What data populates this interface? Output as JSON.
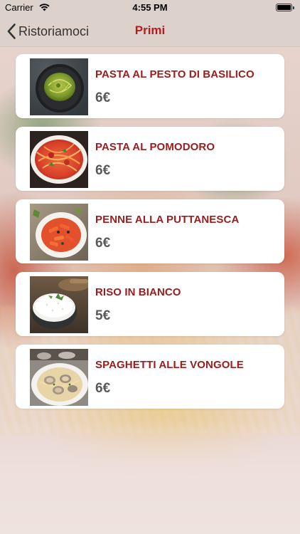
{
  "status_bar": {
    "carrier": "Carrier",
    "time": "4:55 PM"
  },
  "nav": {
    "back_label": "Ristoriamoci",
    "title": "Primi",
    "title_color": "#b51c1c"
  },
  "colors": {
    "dish_name": "#9b1c1c",
    "price": "#5a5a5a",
    "card": "#ffffff"
  },
  "dishes": [
    {
      "name": "PASTA AL PESTO DI BASILICO",
      "price": "6€",
      "photo": "pesto-pasta-photo"
    },
    {
      "name": "PASTA AL POMODORO",
      "price": "6€",
      "photo": "tomato-pasta-photo"
    },
    {
      "name": "PENNE ALLA PUTTANESCA",
      "price": "6€",
      "photo": "penne-puttanesca-photo"
    },
    {
      "name": "RISO IN BIANCO",
      "price": "5€",
      "photo": "white-rice-photo"
    },
    {
      "name": "SPAGHETTI ALLE VONGOLE",
      "price": "6€",
      "photo": "clam-spaghetti-photo"
    }
  ]
}
